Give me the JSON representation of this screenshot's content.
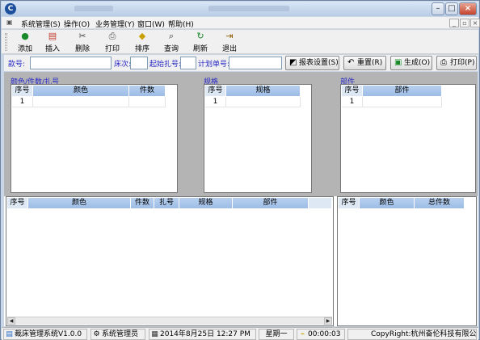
{
  "menubar": {
    "items": [
      "系统管理(S)",
      "操作(O)",
      "业务管理(Y)",
      "窗口(W)",
      "帮助(H)"
    ]
  },
  "toolbar": {
    "buttons": [
      {
        "label": "添加",
        "icon": "add-icon"
      },
      {
        "label": "插入",
        "icon": "insert-icon"
      },
      {
        "label": "删除",
        "icon": "delete-icon"
      },
      {
        "label": "打印",
        "icon": "print-icon"
      },
      {
        "label": "排序",
        "icon": "sort-icon"
      },
      {
        "label": "查询",
        "icon": "search-icon"
      },
      {
        "label": "刷新",
        "icon": "refresh-icon"
      },
      {
        "label": "退出",
        "icon": "exit-icon"
      }
    ]
  },
  "inputbar": {
    "fields": [
      {
        "label": "款号:",
        "value": ""
      },
      {
        "label": "床次:",
        "value": ""
      },
      {
        "label": "起始扎号:",
        "value": ""
      },
      {
        "label": "计划单号:",
        "value": ""
      }
    ],
    "buttons": [
      {
        "label": "报表设置(S)",
        "icon": "report-settings-icon"
      },
      {
        "label": "重置(R)",
        "icon": "reset-icon"
      },
      {
        "label": "生成(O)",
        "icon": "generate-icon"
      },
      {
        "label": "打印(P)",
        "icon": "print-icon"
      }
    ]
  },
  "panels": {
    "color": {
      "title": "颜色/件数/扎号",
      "columns": [
        "序号",
        "颜色",
        "件数"
      ],
      "rows": [
        [
          "1",
          "",
          ""
        ]
      ]
    },
    "spec": {
      "title": "规格",
      "columns": [
        "序号",
        "规格"
      ],
      "rows": [
        [
          "1",
          ""
        ]
      ]
    },
    "part": {
      "title": "部件",
      "columns": [
        "序号",
        "部件"
      ],
      "rows": [
        [
          "1",
          ""
        ]
      ]
    }
  },
  "result_grid": {
    "columns": [
      "序号",
      "颜色",
      "件数",
      "扎号",
      "规格",
      "部件"
    ]
  },
  "summary_grid": {
    "columns": [
      "序号",
      "颜色",
      "总件数"
    ]
  },
  "statusbar": {
    "app": "裁床管理系统V1.0.0",
    "user": "系统管理员",
    "datetime": "2014年8月25日 12:27 PM",
    "weekday": "星期一",
    "elapsed": "00:00:03",
    "copyright": "CopyRight:杭州奋伦科技有限公司"
  }
}
